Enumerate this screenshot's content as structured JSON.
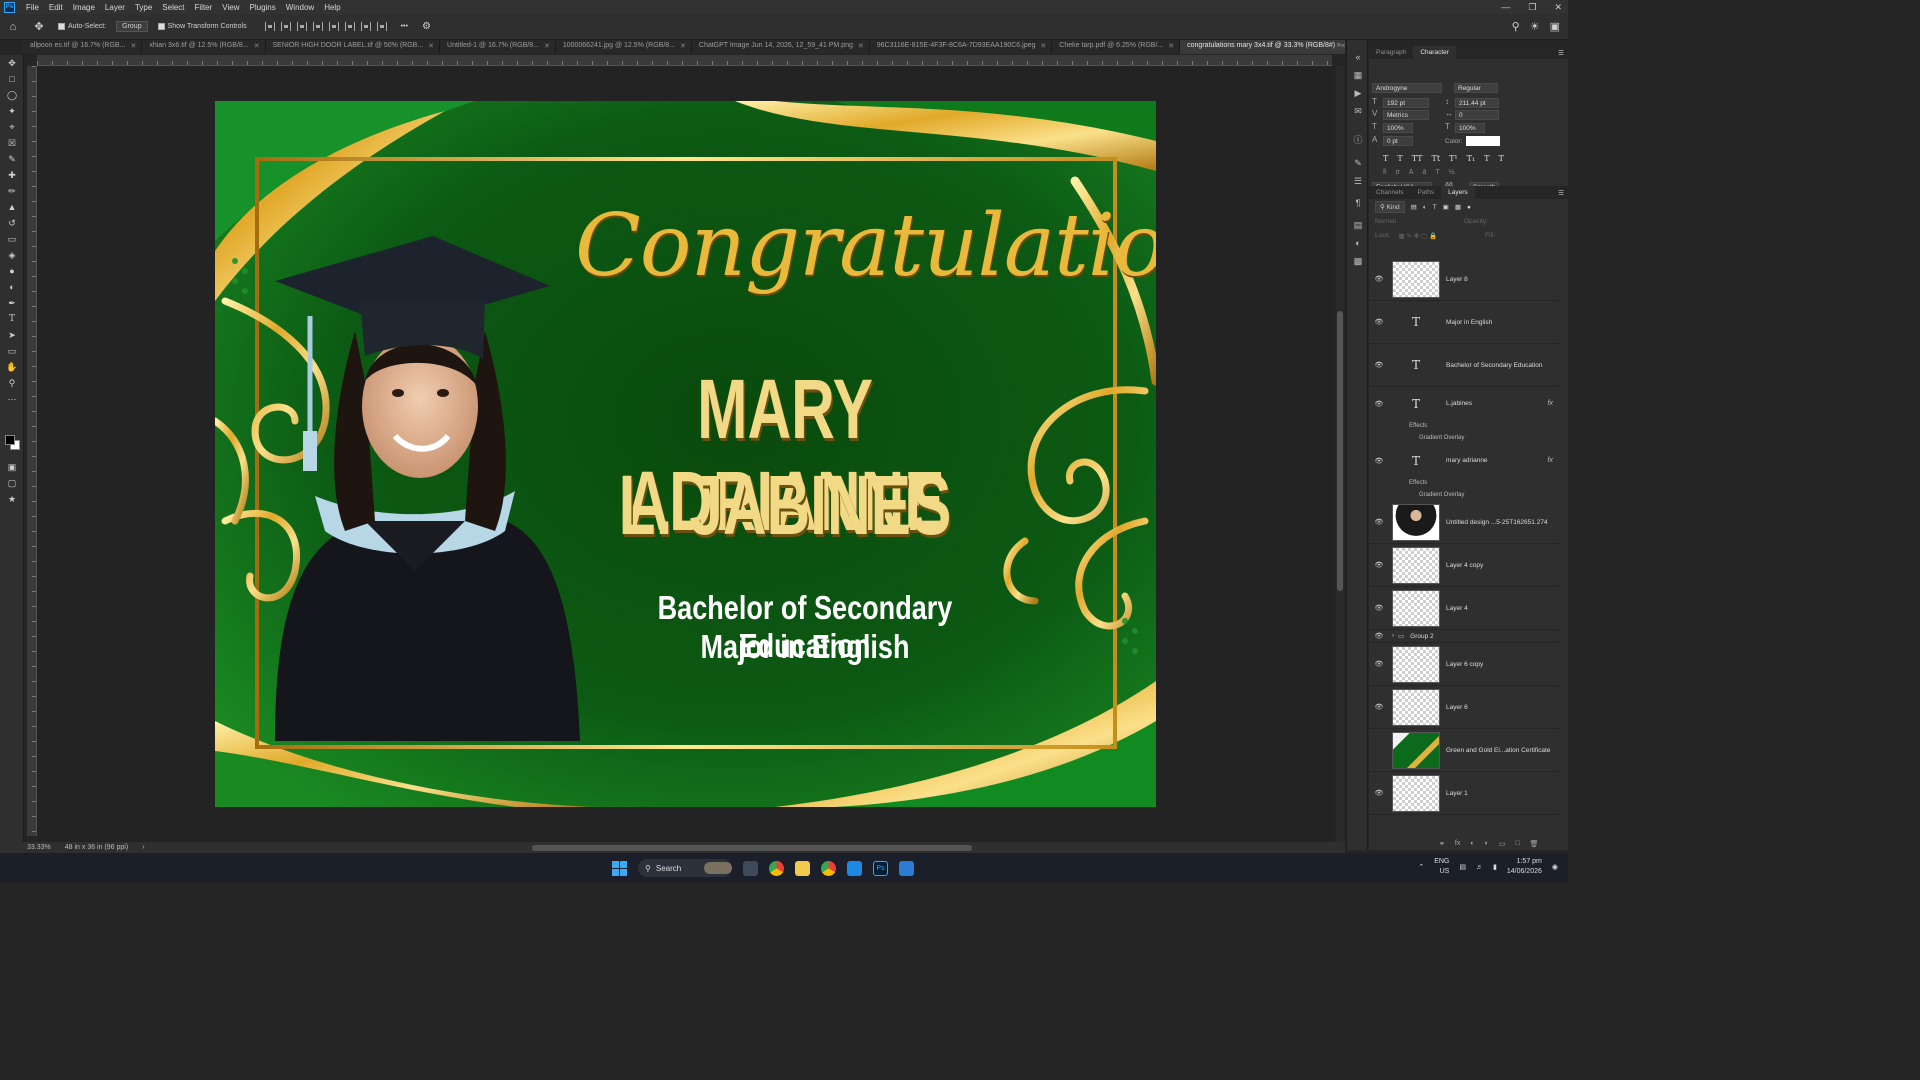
{
  "menu": [
    "File",
    "Edit",
    "Image",
    "Layer",
    "Type",
    "Select",
    "Filter",
    "View",
    "Plugins",
    "Window",
    "Help"
  ],
  "options": {
    "auto_select": "Auto-Select:",
    "group": "Group",
    "show_transform": "Show Transform Controls",
    "more": "•••"
  },
  "tabs": [
    {
      "label": "allpoon es.tif @ 16.7% (RGB...",
      "active": false
    },
    {
      "label": "xhian 3x6.tif @ 12.5% (RGB/8...",
      "active": false
    },
    {
      "label": "SENIOR HIGH DOOR LABEL.tif @ 50% (RGB...",
      "active": false
    },
    {
      "label": "Untitled-1 @ 16.7% (RGB/8...",
      "active": false
    },
    {
      "label": "1000066241.jpg @ 12.5% (RGB/8...",
      "active": false
    },
    {
      "label": "ChatGPT Image Jun 14, 2026, 12_59_41 PM.png",
      "active": false
    },
    {
      "label": "96C3116E-815E-4F3F-8C6A-7D93EAA190C6.jpeg",
      "active": false
    },
    {
      "label": "Cheke tarp.pdf @ 6.25% (RGB/...",
      "active": false
    },
    {
      "label": "congratulations mary 3x4.tif @ 33.3% (RGB/8#)",
      "active": true
    }
  ],
  "certificate": {
    "congrats": "Congratulations",
    "name_line1": "MARY ADRIANNE",
    "name_line2": "L. JABINES",
    "degree": "Bachelor of Secondary Education",
    "major": "Major in English"
  },
  "status": {
    "zoom": "33.33%",
    "doc_size": "48 in x 36 in (96 ppi)"
  },
  "character_panel": {
    "tabs": [
      "Paragraph",
      "Character"
    ],
    "font_family": "Androgyne",
    "font_style": "Regular",
    "font_size": "192 pt",
    "leading": "211.44 pt",
    "kerning": "Metrics",
    "tracking": "0",
    "vertical_scale": "100%",
    "horizontal_scale": "100%",
    "baseline_shift": "0 pt",
    "color_label": "Color:",
    "language": "English: USA",
    "antialias": "Smooth"
  },
  "layers_panel": {
    "tabs": [
      "Channels",
      "Paths",
      "Layers"
    ],
    "filter_label": "Kind",
    "blend_mode": "Normal",
    "opacity_label": "Opacity:",
    "lock_label": "Lock:",
    "fill_label": "Fill:",
    "layers": [
      {
        "name": "Layer 8",
        "kind": "pixel"
      },
      {
        "name": "Major in English",
        "kind": "type"
      },
      {
        "name": "Bachelor of Secondary Education",
        "kind": "type"
      },
      {
        "name": "L.jabines",
        "kind": "type",
        "fx": true
      },
      {
        "name": "Effects",
        "kind": "effects-label"
      },
      {
        "name": "Gradient Overlay",
        "kind": "effect"
      },
      {
        "name": "mary adrianne",
        "kind": "type",
        "fx": true
      },
      {
        "name": "Effects",
        "kind": "effects-label"
      },
      {
        "name": "Gradient Overlay",
        "kind": "effect"
      },
      {
        "name": "Untitled design ...5-25T162651.274",
        "kind": "photo"
      },
      {
        "name": "Layer 4 copy",
        "kind": "pixel"
      },
      {
        "name": "Layer 4",
        "kind": "pixel"
      },
      {
        "name": "Group 2",
        "kind": "group"
      },
      {
        "name": "Layer 6 copy",
        "kind": "pixel"
      },
      {
        "name": "Layer 6",
        "kind": "pixel"
      },
      {
        "name": "Green and Gold El...ation Certificate",
        "kind": "cert"
      },
      {
        "name": "Layer 1",
        "kind": "pixel"
      }
    ]
  },
  "taskbar": {
    "search": "Search",
    "lang_line1": "ENG",
    "lang_line2": "US",
    "time": "1:57 pm",
    "date": "14/06/2026"
  },
  "colors": {
    "ps_blue": "#31a8ff",
    "cert_green": "#0d5a12",
    "gold": "#e8b93a"
  }
}
